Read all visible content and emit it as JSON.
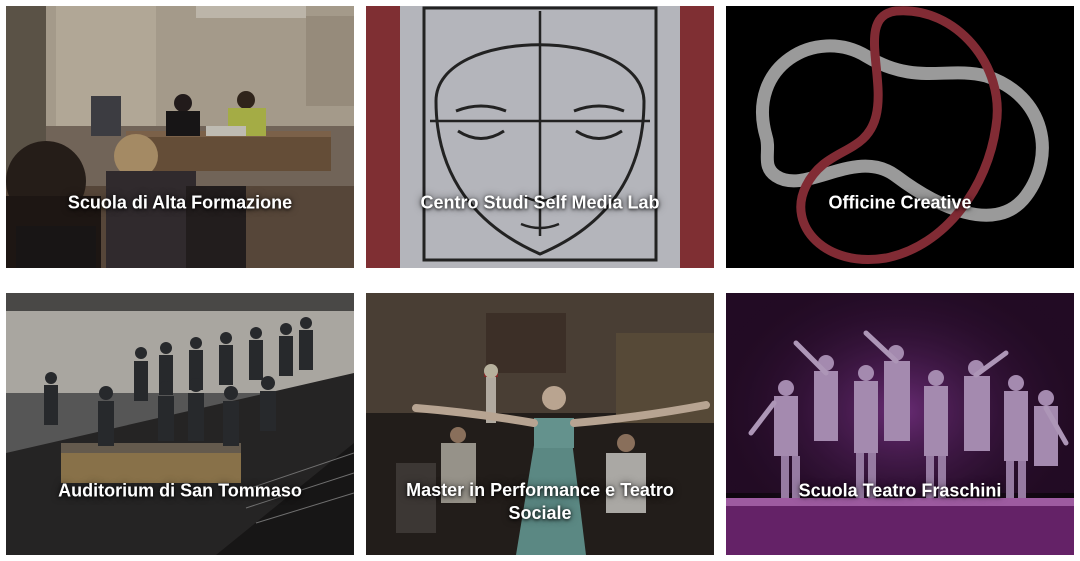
{
  "cards": [
    {
      "title": "Scuola di Alta Formazione"
    },
    {
      "title": "Centro Studi Self Media Lab"
    },
    {
      "title": "Officine Creative"
    },
    {
      "title": "Auditorium di San Tommaso"
    },
    {
      "title": "Master in Performance e Teatro Sociale"
    },
    {
      "title": "Scuola Teatro Fraschini"
    }
  ],
  "colors": {
    "brand_red": "#8c2f39",
    "sketch_paper": "#dcdde4",
    "officine_bg": "#000000",
    "stage_purple": "#6a2a78"
  }
}
